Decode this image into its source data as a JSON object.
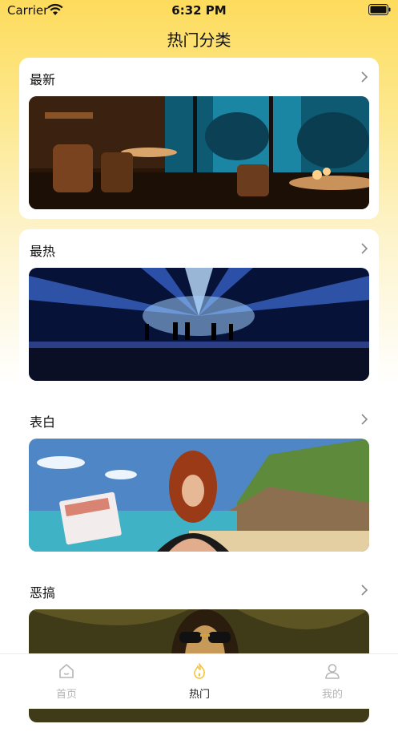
{
  "status_bar": {
    "carrier": "Carrier",
    "time": "6:32 PM"
  },
  "header": {
    "title": "热门分类"
  },
  "categories": [
    {
      "label": "最新",
      "image": "restaurant-aquarium-image"
    },
    {
      "label": "最热",
      "image": "concert-stage-image"
    },
    {
      "label": "表白",
      "image": "beach-woman-image"
    },
    {
      "label": "恶搞",
      "image": "sunglasses-portrait-image"
    }
  ],
  "tab_bar": {
    "tabs": [
      {
        "label": "首页",
        "icon": "home-icon",
        "active": false
      },
      {
        "label": "热门",
        "icon": "flame-icon",
        "active": true
      },
      {
        "label": "我的",
        "icon": "user-icon",
        "active": false
      }
    ]
  },
  "colors": {
    "header_gradient_top": "#fddb5c",
    "active_tab_icon": "#f5c43b",
    "inactive_tab": "#b5b5b5"
  }
}
